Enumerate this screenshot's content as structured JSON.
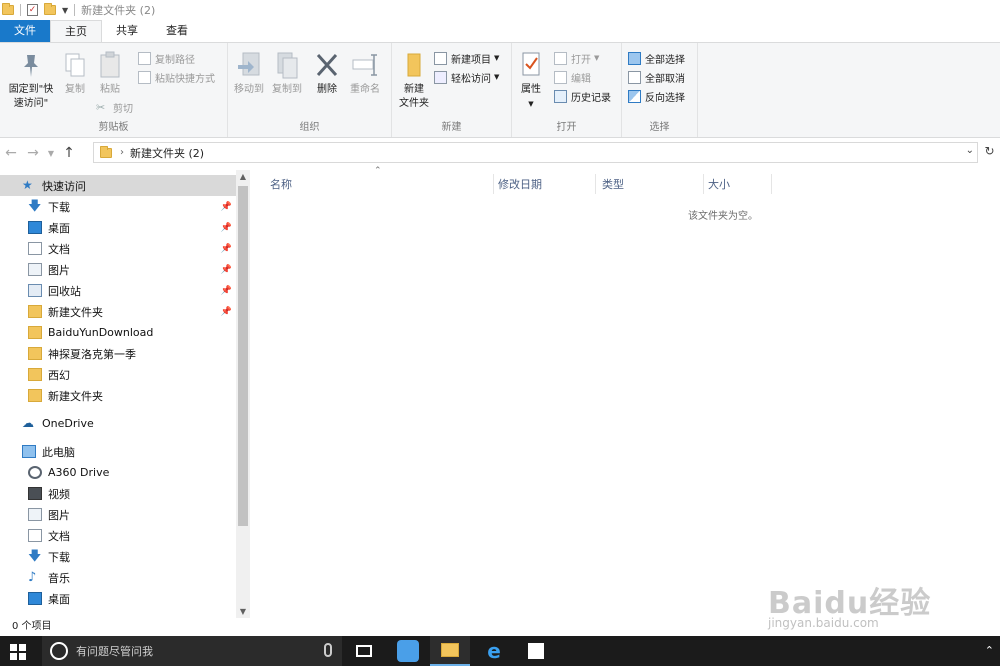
{
  "window": {
    "title": "新建文件夹 (2)"
  },
  "tabs": [
    {
      "label": "文件"
    },
    {
      "label": "主页"
    },
    {
      "label": "共享"
    },
    {
      "label": "查看"
    }
  ],
  "ribbon": {
    "clipboard": {
      "group_label": "剪贴板",
      "pin_quick": "固定到\"快\n速访问\"",
      "pin_quick_l1": "固定到\"快",
      "pin_quick_l2": "速访问\"",
      "copy": "复制",
      "paste": "粘贴",
      "copy_path": "复制路径",
      "paste_shortcut": "粘贴快捷方式",
      "cut": "剪切"
    },
    "organize": {
      "group_label": "组织",
      "move_to": "移动到",
      "copy_to": "复制到",
      "delete": "删除",
      "rename": "重命名"
    },
    "new": {
      "group_label": "新建",
      "new_folder_l1": "新建",
      "new_folder_l2": "文件夹",
      "new_item": "新建项目",
      "easy_access": "轻松访问"
    },
    "open": {
      "group_label": "打开",
      "properties": "属性",
      "open": "打开",
      "edit": "编辑",
      "history": "历史记录"
    },
    "select": {
      "group_label": "选择",
      "select_all": "全部选择",
      "select_none": "全部取消",
      "invert": "反向选择"
    }
  },
  "address": {
    "crumb": "新建文件夹 (2)"
  },
  "navpane": {
    "quick_access": "快速访问",
    "quick_items": [
      {
        "label": "下载",
        "pinned": true,
        "icon": "download-icon"
      },
      {
        "label": "桌面",
        "pinned": true,
        "icon": "desktop-icon"
      },
      {
        "label": "文档",
        "pinned": true,
        "icon": "document-icon"
      },
      {
        "label": "图片",
        "pinned": true,
        "icon": "picture-icon"
      },
      {
        "label": "回收站",
        "pinned": true,
        "icon": "recycle-bin-icon"
      },
      {
        "label": "新建文件夹",
        "pinned": true,
        "icon": "folder-icon"
      },
      {
        "label": "BaiduYunDownload",
        "pinned": false,
        "icon": "folder-icon"
      },
      {
        "label": "神探夏洛克第一季",
        "pinned": false,
        "icon": "folder-icon"
      },
      {
        "label": "西幻",
        "pinned": false,
        "icon": "folder-icon"
      },
      {
        "label": "新建文件夹",
        "pinned": false,
        "icon": "folder-icon"
      }
    ],
    "onedrive": "OneDrive",
    "this_pc": "此电脑",
    "pc_items": [
      {
        "label": "A360 Drive",
        "icon": "a360-drive-icon"
      },
      {
        "label": "视频",
        "icon": "video-icon"
      },
      {
        "label": "图片",
        "icon": "picture-icon"
      },
      {
        "label": "文档",
        "icon": "document-icon"
      },
      {
        "label": "下载",
        "icon": "download-icon"
      },
      {
        "label": "音乐",
        "icon": "music-icon"
      },
      {
        "label": "桌面",
        "icon": "desktop-icon"
      }
    ]
  },
  "columns": [
    {
      "label": "名称"
    },
    {
      "label": "修改日期"
    },
    {
      "label": "类型"
    },
    {
      "label": "大小"
    }
  ],
  "content": {
    "empty_message": "该文件夹为空。"
  },
  "status": {
    "item_count": "0 个项目"
  },
  "taskbar": {
    "search_placeholder": "有问题尽管问我"
  },
  "watermark": {
    "brand": "Baidu经验",
    "url": "jingyan.baidu.com"
  },
  "colors": {
    "file_tab": "#1979ca",
    "ribbon_bg": "#f5f6f7",
    "selected_nav": "#d9d9d9",
    "taskbar": "#1b1b1b",
    "column_header_text": "#4d6185"
  }
}
